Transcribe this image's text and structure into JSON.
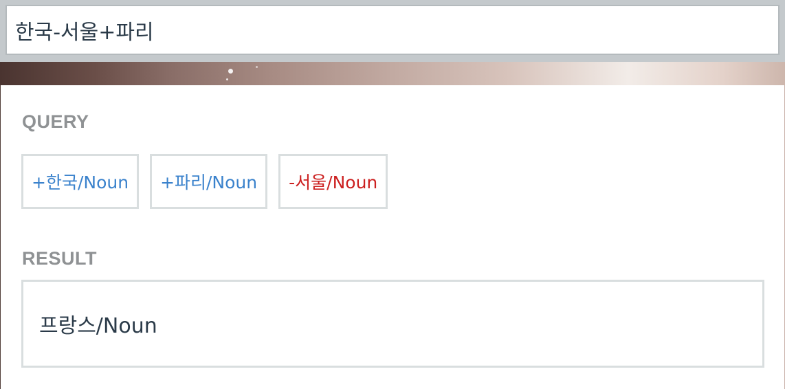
{
  "search": {
    "value": "한국-서울+파리"
  },
  "query": {
    "label": "QUERY",
    "tags": [
      {
        "text": "+한국/Noun",
        "sign": "plus"
      },
      {
        "text": "+파리/Noun",
        "sign": "plus"
      },
      {
        "text": "-서울/Noun",
        "sign": "minus"
      }
    ]
  },
  "result": {
    "label": "RESULT",
    "items": [
      "프랑스/Noun"
    ]
  },
  "colors": {
    "plus": "#3a82cc",
    "minus": "#cc2020",
    "label": "#8f9294",
    "text": "#2a3a48",
    "border": "#d9dedf"
  }
}
